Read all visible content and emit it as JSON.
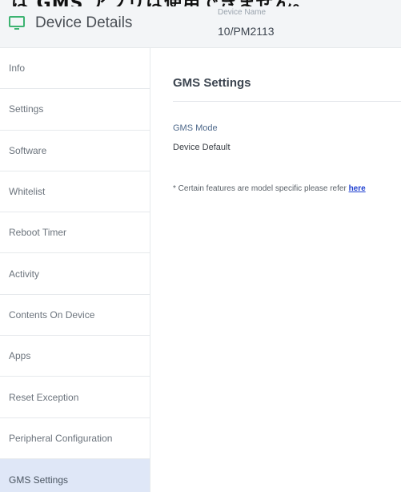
{
  "top_strip": {
    "text": "は GMS アプリは使用できません。"
  },
  "header": {
    "title": "Device Details",
    "device_name_label": "Device Name",
    "device_name_value": "10/PM2113"
  },
  "sidebar": {
    "items": [
      {
        "label": "Info"
      },
      {
        "label": "Settings"
      },
      {
        "label": "Software"
      },
      {
        "label": "Whitelist"
      },
      {
        "label": "Reboot Timer"
      },
      {
        "label": "Activity"
      },
      {
        "label": "Contents On Device"
      },
      {
        "label": "Apps"
      },
      {
        "label": "Reset Exception"
      },
      {
        "label": "Peripheral Configuration"
      },
      {
        "label": "GMS Settings"
      }
    ],
    "active": "GMS Settings"
  },
  "main": {
    "section_title": "GMS Settings",
    "gms_mode_label": "GMS Mode",
    "gms_mode_value": "Device Default",
    "note_text": "* Certain features are model specific please refer ",
    "note_link": "here"
  },
  "colors": {
    "accent_green": "#3cb371",
    "active_bg": "#dfe7f7",
    "link": "#1e3fd0"
  },
  "icons": {
    "header_icon": "monitor-icon"
  }
}
